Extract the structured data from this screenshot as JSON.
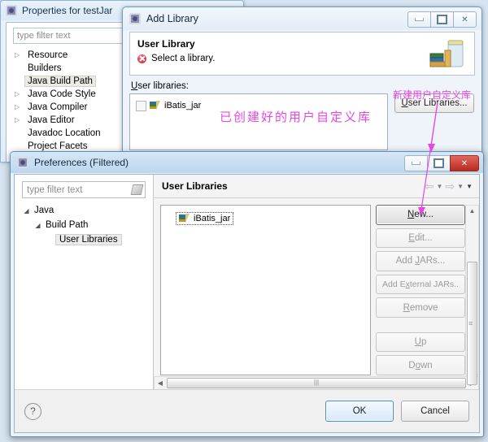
{
  "properties_window": {
    "title": "Properties for testJar",
    "icon": "eclipse-app-icon",
    "filter_placeholder": "type filter text",
    "tree": [
      {
        "label": "Resource",
        "expandable": true,
        "selected": false
      },
      {
        "label": "Builders",
        "expandable": false,
        "selected": false
      },
      {
        "label": "Java Build Path",
        "expandable": false,
        "selected": true
      },
      {
        "label": "Java Code Style",
        "expandable": true,
        "selected": false
      },
      {
        "label": "Java Compiler",
        "expandable": true,
        "selected": false
      },
      {
        "label": "Java Editor",
        "expandable": true,
        "selected": false
      },
      {
        "label": "Javadoc Location",
        "expandable": false,
        "selected": false
      },
      {
        "label": "Project Facets",
        "expandable": false,
        "selected": false
      }
    ]
  },
  "add_library_dialog": {
    "title": "Add Library",
    "icon": "eclipse-app-icon",
    "window_buttons": {
      "minimize": "minimize-icon",
      "maximize": "maximize-icon",
      "close": "close-icon"
    },
    "header_title": "User Library",
    "header_message": "Select a library.",
    "header_status": "error",
    "list_label": "User libraries:",
    "libraries": [
      {
        "name": "iBatis_jar",
        "checked": false,
        "icon": "library-jar-icon"
      }
    ],
    "user_libraries_button": "User Libraries..."
  },
  "preferences_window": {
    "title": "Preferences (Filtered)",
    "icon": "eclipse-app-icon",
    "window_buttons": {
      "minimize": "minimize-icon",
      "restore": "restore-icon",
      "close": "close-icon"
    },
    "filter_placeholder": "type filter text",
    "tree": [
      {
        "label": "Java",
        "depth": 0,
        "expanded": true,
        "selected": false
      },
      {
        "label": "Build Path",
        "depth": 1,
        "expanded": true,
        "selected": false
      },
      {
        "label": "User Libraries",
        "depth": 2,
        "expanded": false,
        "selected": true
      }
    ],
    "page_title": "User Libraries",
    "nav": {
      "back": "back-arrow-icon",
      "forward": "forward-arrow-icon",
      "menu": "view-menu-icon"
    },
    "library_list": [
      {
        "name": "iBatis_jar",
        "selected": true,
        "icon": "library-jar-icon"
      }
    ],
    "buttons": [
      {
        "label": "New...",
        "mnemonic": "N",
        "enabled": true,
        "focused": true
      },
      {
        "label": "Edit...",
        "mnemonic": "E",
        "enabled": false,
        "focused": false
      },
      {
        "label": "Add JARs...",
        "mnemonic": "J",
        "enabled": false,
        "focused": false
      },
      {
        "label": "Add External JARs..",
        "mnemonic": "x",
        "enabled": false,
        "focused": false
      },
      {
        "label": "Remove",
        "mnemonic": "R",
        "enabled": false,
        "focused": false
      },
      {
        "label": "Up",
        "mnemonic": "U",
        "enabled": false,
        "focused": false
      },
      {
        "label": "Down",
        "mnemonic": "o",
        "enabled": false,
        "focused": false
      }
    ],
    "footer": {
      "help_icon": "help-icon",
      "ok_label": "OK",
      "cancel_label": "Cancel"
    }
  },
  "annotations": {
    "existing_library_note": "已创建好的用户自定义库",
    "new_library_note": "新建用户自定义库",
    "color": "#e548e5"
  }
}
